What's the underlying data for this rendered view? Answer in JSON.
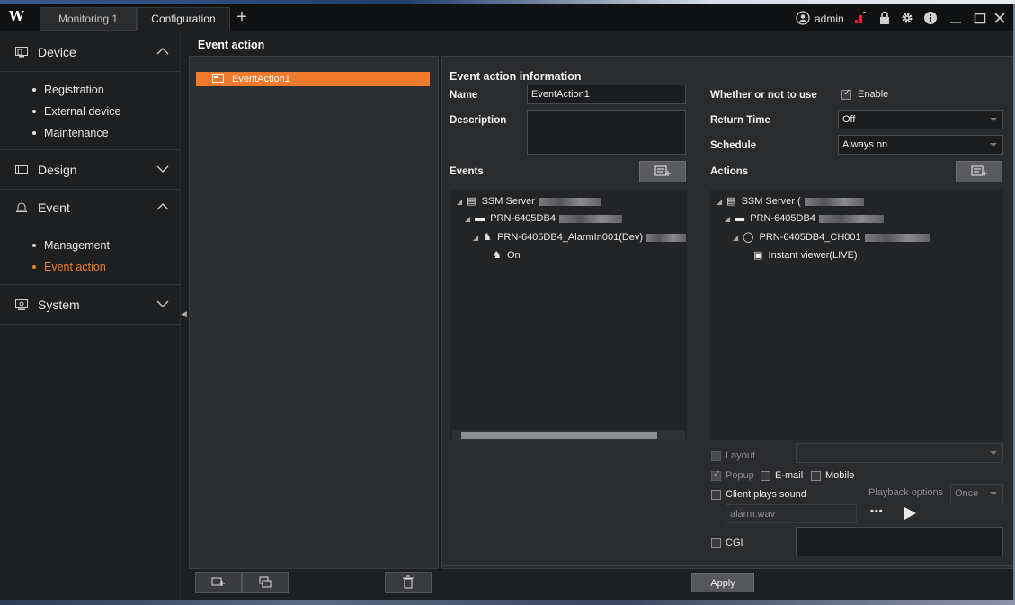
{
  "app": {
    "logo": "W",
    "tabs": [
      {
        "label": "Monitoring 1"
      },
      {
        "label": "Configuration"
      }
    ],
    "add_tab": "+",
    "user": "admin",
    "icons": [
      "user-icon",
      "alarm-indicator-icon",
      "lock-icon",
      "gear-icon",
      "info-icon",
      "minimize-icon",
      "maximize-icon",
      "close-icon"
    ]
  },
  "sidebar": {
    "sections": [
      {
        "label": "Device",
        "items": [
          "Registration",
          "External device",
          "Maintenance"
        ],
        "expanded": true
      },
      {
        "label": "Design",
        "expanded": false
      },
      {
        "label": "Event",
        "items": [
          "Management",
          "Event action"
        ],
        "expanded": true,
        "active_item": "Event action"
      },
      {
        "label": "System",
        "expanded": false
      }
    ],
    "accent_color": "#f07a2b"
  },
  "page": {
    "title": "Event action",
    "list": [
      {
        "label": "EventAction1",
        "selected": true
      }
    ]
  },
  "info": {
    "heading": "Event action information",
    "name_label": "Name",
    "name_value": "EventAction1",
    "description_label": "Description",
    "description_value": "",
    "use_label": "Whether or not to use",
    "enable_label": "Enable",
    "enable_checked": true,
    "return_time_label": "Return Time",
    "return_time_value": "Off",
    "schedule_label": "Schedule",
    "schedule_value": "Always on"
  },
  "events": {
    "label": "Events",
    "tree": [
      {
        "level": 0,
        "label": "SSM Server",
        "icon": "server-icon"
      },
      {
        "level": 1,
        "label": "PRN-6405DB4",
        "icon": "recorder-icon"
      },
      {
        "level": 2,
        "label": "PRN-6405DB4_AlarmIn001(Dev)",
        "icon": "alarm-input-icon"
      },
      {
        "level": 3,
        "label": "On",
        "icon": "alarm-input-icon"
      }
    ]
  },
  "actions": {
    "label": "Actions",
    "tree": [
      {
        "level": 0,
        "label": "SSM Server (",
        "icon": "server-icon"
      },
      {
        "level": 1,
        "label": "PRN-6405DB4",
        "icon": "recorder-icon"
      },
      {
        "level": 2,
        "label": "PRN-6405DB4_CH001",
        "icon": "camera-icon"
      },
      {
        "level": 3,
        "label": "Instant viewer(LIVE)",
        "icon": "viewer-icon"
      }
    ]
  },
  "options": {
    "layout_label": "Layout",
    "popup_label": "Popup",
    "popup_checked": true,
    "email_label": "E-mail",
    "mobile_label": "Mobile",
    "client_sound_label": "Client plays sound",
    "playback_options_label": "Playback options",
    "playback_value": "Once",
    "sound_file": "alarm.wav",
    "browse_label": "•••",
    "cgi_label": "CGI"
  },
  "apply_label": "Apply"
}
